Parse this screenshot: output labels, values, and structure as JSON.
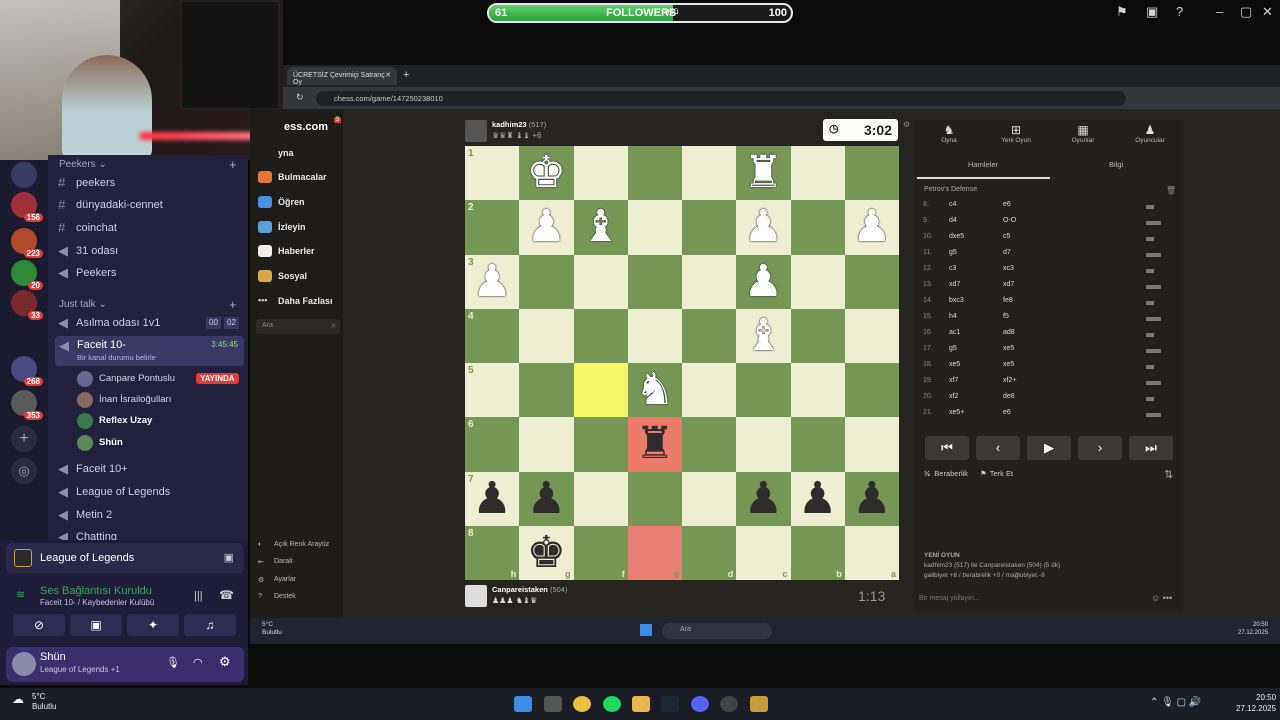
{
  "overlay": {
    "followers_label": "FOLLOWERS",
    "followers_current": "61",
    "followers_goal": "100",
    "followers_progress": 0.61,
    "sub_label": "ubü"
  },
  "discord": {
    "categories": [
      {
        "label": "Peekers",
        "channels": [
          "peekers",
          "dünyadaki-cennet",
          "coinchat",
          "31 odası",
          "Peekers"
        ]
      },
      {
        "label": "Just talk"
      }
    ],
    "voice_channels": {
      "asilma": "Asılma odası 1v1",
      "asilma_c1": "00",
      "asilma_c2": "02",
      "faceit": "Faceit 10-",
      "faceit_timer": "3:45:45",
      "faceit_status": "Bir kanal durumu belirle",
      "users": [
        "Canpare Pontuslu",
        "İnan İsrailoğulları",
        "Reflex Uzay",
        "Shün"
      ],
      "live_badge": "YAYINDA",
      "others": [
        "Faceit 10+",
        "League of Legends",
        "Metin 2",
        "Chatting"
      ]
    },
    "server_badges": [
      "156",
      "223",
      "20",
      "33",
      "268",
      "353"
    ],
    "activity": "League of Legends",
    "voice_connected": "Ses Bağlantısı Kuruldu",
    "voice_location": "Faceit 10- / Kaybedenler Kulübü",
    "user_name": "Shün",
    "user_status": "League of Legends +1"
  },
  "browser": {
    "tab_title": "ÜCRETSİZ Çevrimiçi Satranç Oy",
    "url": "chess.com/game/147250238010",
    "logo": "ess.com",
    "notif": "5"
  },
  "chesscom_nav": [
    "yna",
    "Bulmacalar",
    "Öğren",
    "İzleyin",
    "Haberler",
    "Sosyal",
    "Daha Fazlası"
  ],
  "chesscom_search": "Ara",
  "chesscom_bottom": [
    "Açık Renk Arayüz",
    "Daralt",
    "Ayarlar",
    "Destek"
  ],
  "players": {
    "top": {
      "name": "kadhim23",
      "rating": "(517)",
      "captured": "♛♛♜ ♝♝ +6",
      "clock": "3:02"
    },
    "bottom": {
      "name": "Canpareistaken",
      "rating": "(504)",
      "captured": "♟♟♟ ♞♝♛",
      "clock": "1:13"
    }
  },
  "board": {
    "ranks": [
      "1",
      "2",
      "3",
      "4",
      "5",
      "6",
      "7",
      "8"
    ],
    "files": [
      "h",
      "g",
      "f",
      "e",
      "d",
      "c",
      "b",
      "a"
    ],
    "rows": [
      [
        "",
        "wK",
        "",
        "",
        "",
        "wR",
        "",
        ""
      ],
      [
        "",
        "wP",
        "wB",
        "",
        "",
        "wP",
        "",
        "wP"
      ],
      [
        "wP",
        "",
        "",
        "",
        "",
        "wP",
        "",
        ""
      ],
      [
        "",
        "",
        "",
        "",
        "",
        "wB",
        "",
        ""
      ],
      [
        "",
        "",
        "",
        "wN",
        "",
        "",
        "",
        ""
      ],
      [
        "",
        "",
        "",
        "bR",
        "",
        "",
        "",
        ""
      ],
      [
        "bP",
        "bP",
        "",
        "",
        "",
        "bP",
        "bP",
        "bP"
      ],
      [
        "",
        "bK",
        "",
        "",
        "",
        "",
        "",
        ""
      ]
    ]
  },
  "panel": {
    "tabs": [
      "Oyna",
      "Yeni Oyun",
      "Oyunlar",
      "Oyuncular"
    ],
    "subtabs": [
      "Hamleler",
      "Bilgi"
    ],
    "opening": "Petrov's Defense",
    "moves": [
      [
        "8.",
        "c4",
        "e6"
      ],
      [
        "9.",
        "d4",
        "O-O"
      ],
      [
        "10.",
        "dxe5",
        "c5"
      ],
      [
        "11.",
        "g5",
        "d7"
      ],
      [
        "12.",
        "c3",
        "xc3"
      ],
      [
        "13.",
        "xd7",
        "xd7"
      ],
      [
        "14.",
        "bxc3",
        "fe8"
      ],
      [
        "15.",
        "h4",
        "f5"
      ],
      [
        "16.",
        "ac1",
        "ad8"
      ],
      [
        "17.",
        "g5",
        "xe5"
      ],
      [
        "18.",
        "xe5",
        "xe5"
      ],
      [
        "19.",
        "xf7",
        "xf2+"
      ],
      [
        "20.",
        "xf2",
        "de8"
      ],
      [
        "21.",
        "xe5+",
        "e6"
      ]
    ],
    "draw": "Beraberlik",
    "resign": "Terk Et",
    "newgame_title": "YENİ OYUN",
    "newgame_line1": "kadhim23 (517) ile Canpareistaken (504) (5 dk)",
    "newgame_line2": "galibiyet +8 / berabrelik +0 / mağlubiyet -8",
    "chat_placeholder": "Bir mesaj yollayın..."
  },
  "inner_taskbar": {
    "weather_temp": "5°C",
    "weather_desc": "Bulutlu",
    "search": "Ara",
    "time": "20:50",
    "date": "27.12.2025"
  },
  "taskbar": {
    "weather_temp": "5°C",
    "weather_desc": "Bulutlu",
    "time": "20:50",
    "date": "27.12.2025"
  }
}
